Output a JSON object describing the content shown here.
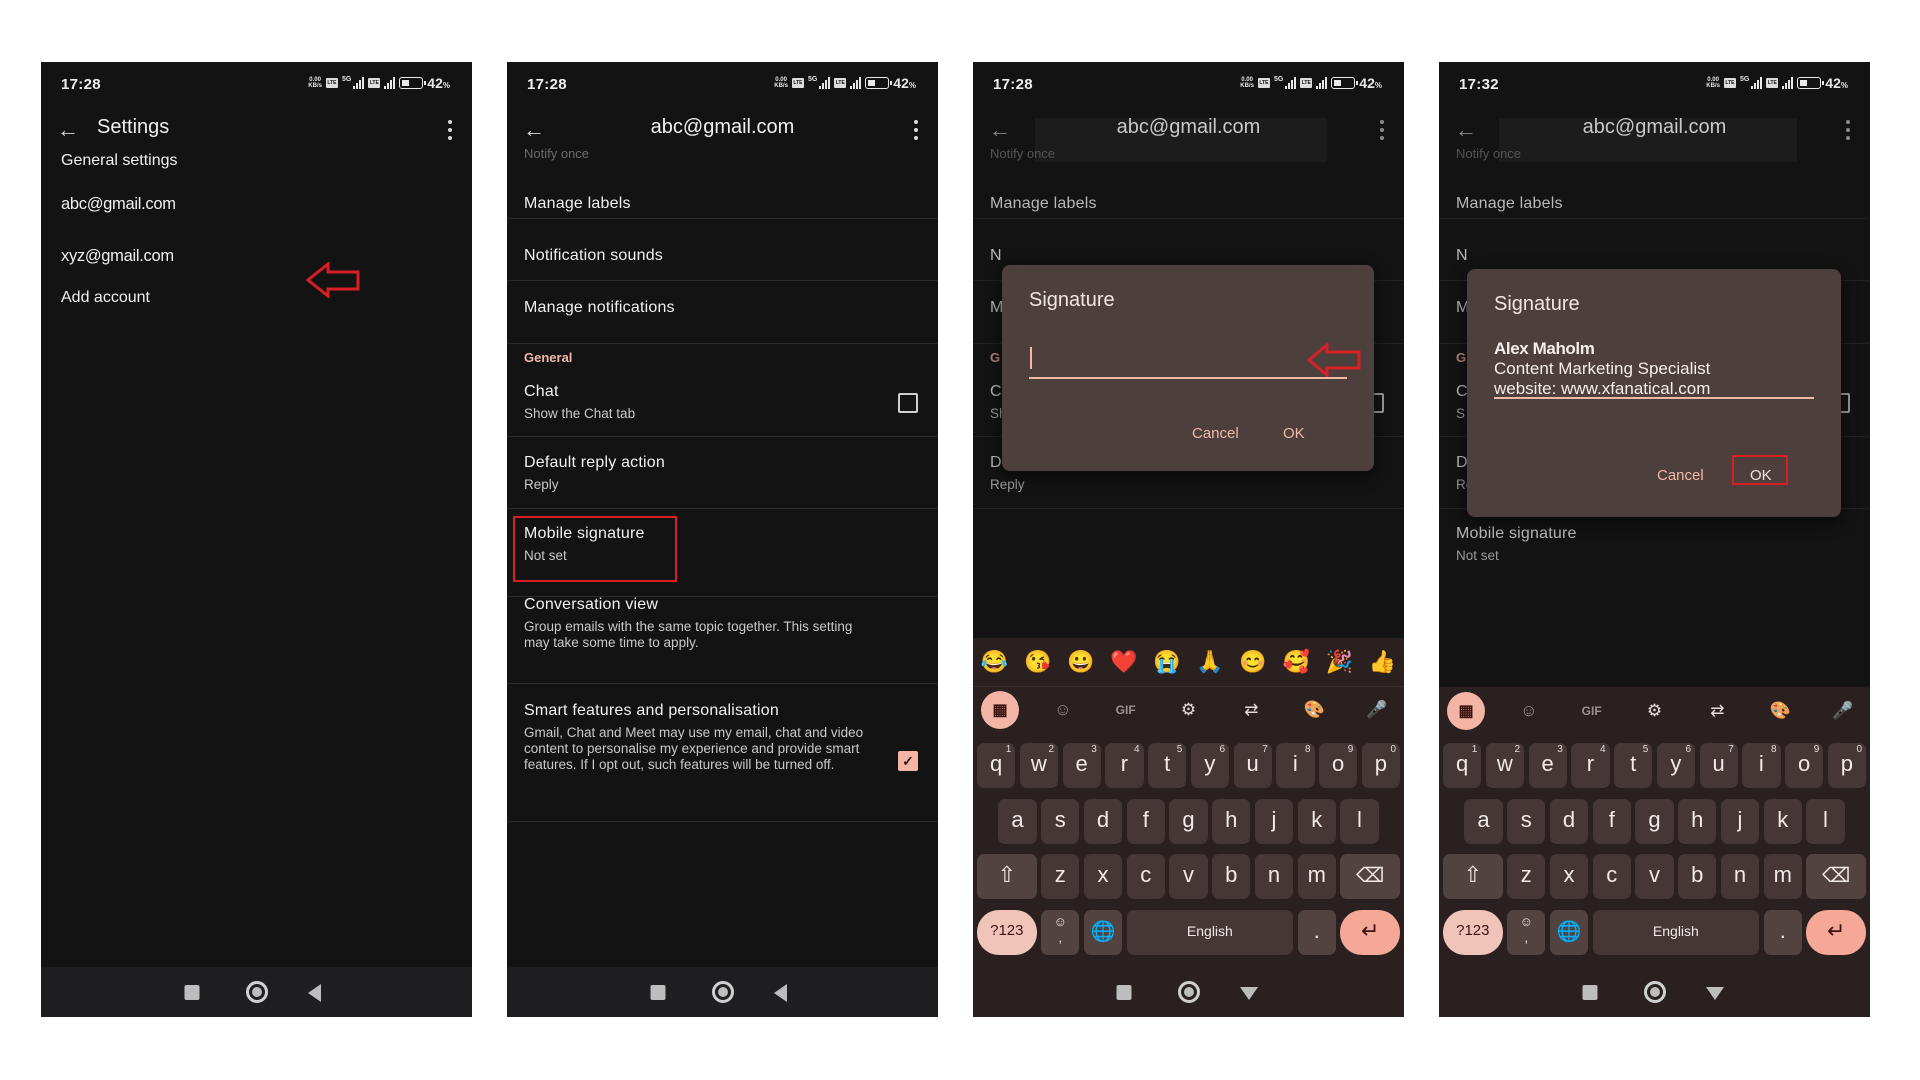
{
  "status_bar": {
    "times": [
      "17:28",
      "17:28",
      "17:28",
      "17:32"
    ],
    "speed_value": "0.00",
    "speed_unit": "KB/s",
    "volte": "Vo LTE",
    "network": "5G",
    "battery": "42",
    "battery_unit": "%"
  },
  "screen1": {
    "title": "Settings",
    "items": [
      "General settings",
      "abc@gmail.com",
      "xyz@gmail.com",
      "Add account"
    ]
  },
  "account_screen": {
    "title": "abc@gmail.com",
    "notify_once": "Notify once",
    "manage_labels": "Manage labels",
    "notification_sounds": "Notification sounds",
    "manage_notifications": "Manage notifications",
    "section_general": "General",
    "chat_title": "Chat",
    "chat_sub": "Show the Chat tab",
    "chat_checked": false,
    "reply_title": "Default reply action",
    "reply_sub": "Reply",
    "signature_title": "Mobile signature",
    "signature_sub": "Not set",
    "conv_title": "Conversation view",
    "conv_sub": "Group emails with the same topic together. This setting may take some time to apply.",
    "conv_checked": true,
    "smart_title": "Smart features and personalisation",
    "smart_sub": "Gmail, Chat and Meet may use my email, chat and video content to personalise my experience and provide smart features. If I opt out, such features will be turned off.",
    "smart_checked": true,
    "partial_letters": [
      "N",
      "M",
      "G",
      "C",
      "S"
    ]
  },
  "dialog": {
    "title": "Signature",
    "cancel": "Cancel",
    "ok": "OK",
    "empty_value": "",
    "filled_lines": [
      "Alex Maholm",
      "Content Marketing Specialist",
      "website: www.xfanatical.com"
    ]
  },
  "keyboard": {
    "emojis": [
      "😂",
      "😘",
      "😀",
      "❤️",
      "😭",
      "🙏",
      "😊",
      "🥰",
      "🎉",
      "👍"
    ],
    "toolbar": {
      "gif": "GIF"
    },
    "row1": [
      "q",
      "w",
      "e",
      "r",
      "t",
      "y",
      "u",
      "i",
      "o",
      "p"
    ],
    "row1_hints": [
      "1",
      "2",
      "3",
      "4",
      "5",
      "6",
      "7",
      "8",
      "9",
      "0"
    ],
    "row2": [
      "a",
      "s",
      "d",
      "f",
      "g",
      "h",
      "j",
      "k",
      "l"
    ],
    "row3": [
      "z",
      "x",
      "c",
      "v",
      "b",
      "n",
      "m"
    ],
    "symbols": "?123",
    "space": "English",
    "period": ".",
    "comma": ","
  },
  "colors": {
    "accent": "#f2b8a8",
    "annotation_red": "#d81f26",
    "dialog_bg": "#4c3f3c",
    "screen_bg": "#131313"
  }
}
